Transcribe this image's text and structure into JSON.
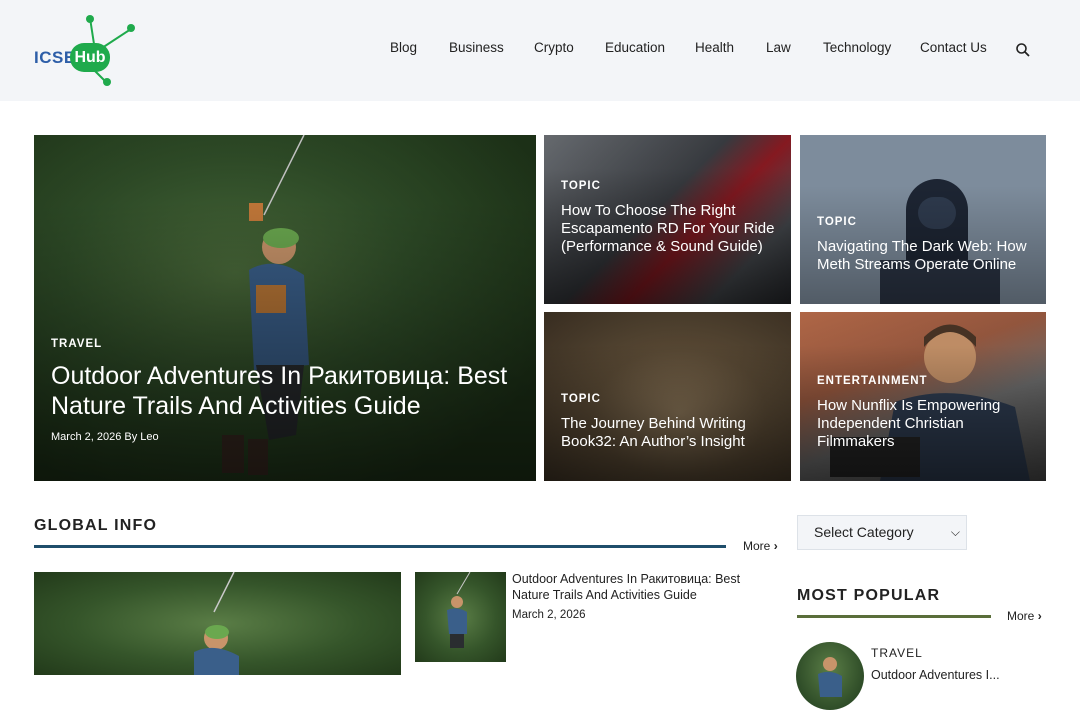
{
  "header": {
    "logo_left": "ICSE",
    "logo_right": "Hub",
    "nav": [
      "Blog",
      "Business",
      "Crypto",
      "Education",
      "Health",
      "Law",
      "Technology",
      "Contact Us"
    ],
    "search_icon": "search-icon"
  },
  "featured": {
    "main": {
      "category": "TRAVEL",
      "title": "Outdoor Adventures In Ракитовица: Best Nature Trails And Activities Guide",
      "meta": "March 2, 2026 By Leo"
    },
    "cards": [
      {
        "category": "TOPIC",
        "title": "How To Choose The Right Escapamento RD For Your Ride (Performance & Sound Guide)"
      },
      {
        "category": "TOPIC",
        "title": "Navigating The Dark Web: How Meth Streams Operate Online"
      },
      {
        "category": "TOPIC",
        "title": "The Journey Behind Writing Book32: An Author’s Insight"
      },
      {
        "category": "ENTERTAINMENT",
        "title": "How Nunflix Is Empowering Independent Christian Filmmakers"
      }
    ]
  },
  "global_info": {
    "heading": "GLOBAL INFO",
    "more": "More",
    "accent_color": "#1f4e6b",
    "side_post": {
      "title": "Outdoor Adventures In Ракитовица: Best Nature Trails And Activities Guide",
      "date": "March 2, 2026"
    }
  },
  "sidebar": {
    "select_label": "Select Category",
    "most_popular": "MOST POPULAR",
    "more": "More",
    "accent_color": "#5a6e3a",
    "popular_item": {
      "category": "TRAVEL",
      "title": "Outdoor Adventures I..."
    }
  }
}
